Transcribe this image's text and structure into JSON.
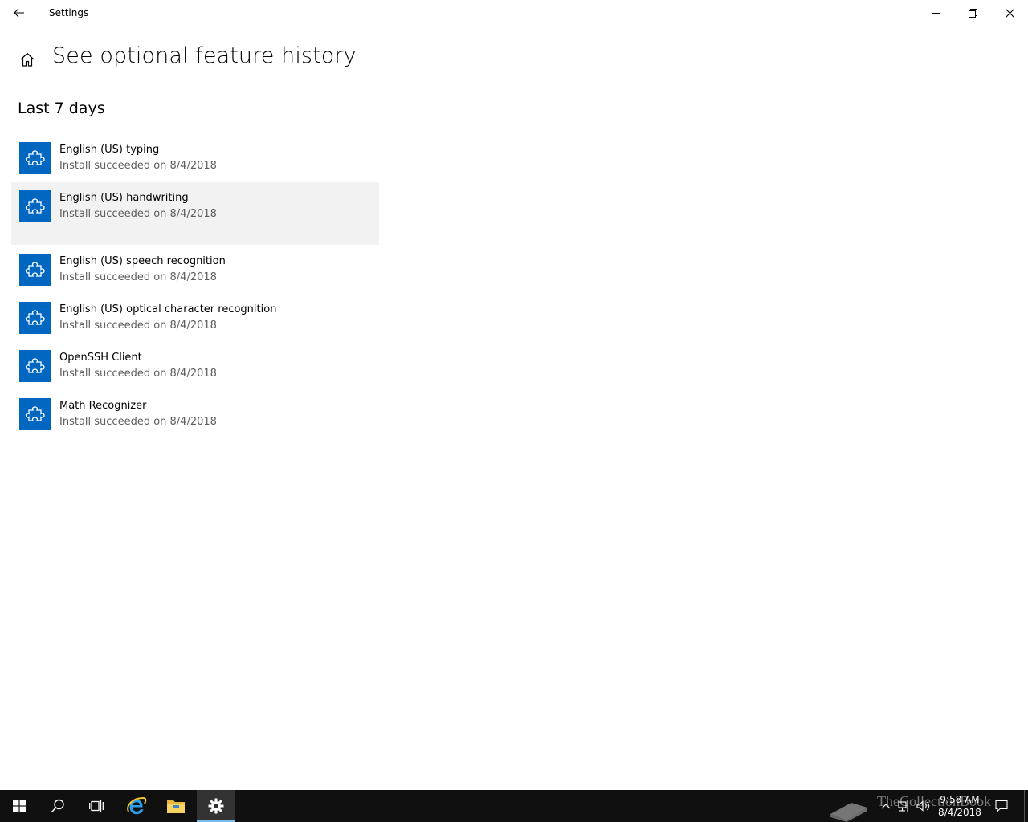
{
  "window": {
    "app_title": "Settings"
  },
  "page": {
    "title": "See optional feature history",
    "section_title": "Last 7 days"
  },
  "features": [
    {
      "name": "English (US) typing",
      "status": "Install succeeded on 8/4/2018"
    },
    {
      "name": "English (US) handwriting",
      "status": "Install succeeded on 8/4/2018"
    },
    {
      "name": "English (US) speech recognition",
      "status": "Install succeeded on 8/4/2018"
    },
    {
      "name": "English (US) optical character recognition",
      "status": "Install succeeded on 8/4/2018"
    },
    {
      "name": "OpenSSH Client",
      "status": "Install succeeded on 8/4/2018"
    },
    {
      "name": "Math Recognizer",
      "status": "Install succeeded on 8/4/2018"
    }
  ],
  "taskbar": {
    "clock_time": "9:58 AM",
    "clock_date": "8/4/2018",
    "watermark": "TheCollectionBook"
  },
  "colors": {
    "accent": "#0067c0",
    "hover_bg": "#f2f2f2",
    "taskbar_bg": "#101010"
  },
  "icons": {
    "feature": "puzzle-piece-icon",
    "back": "back-arrow-icon",
    "home": "home-icon"
  }
}
